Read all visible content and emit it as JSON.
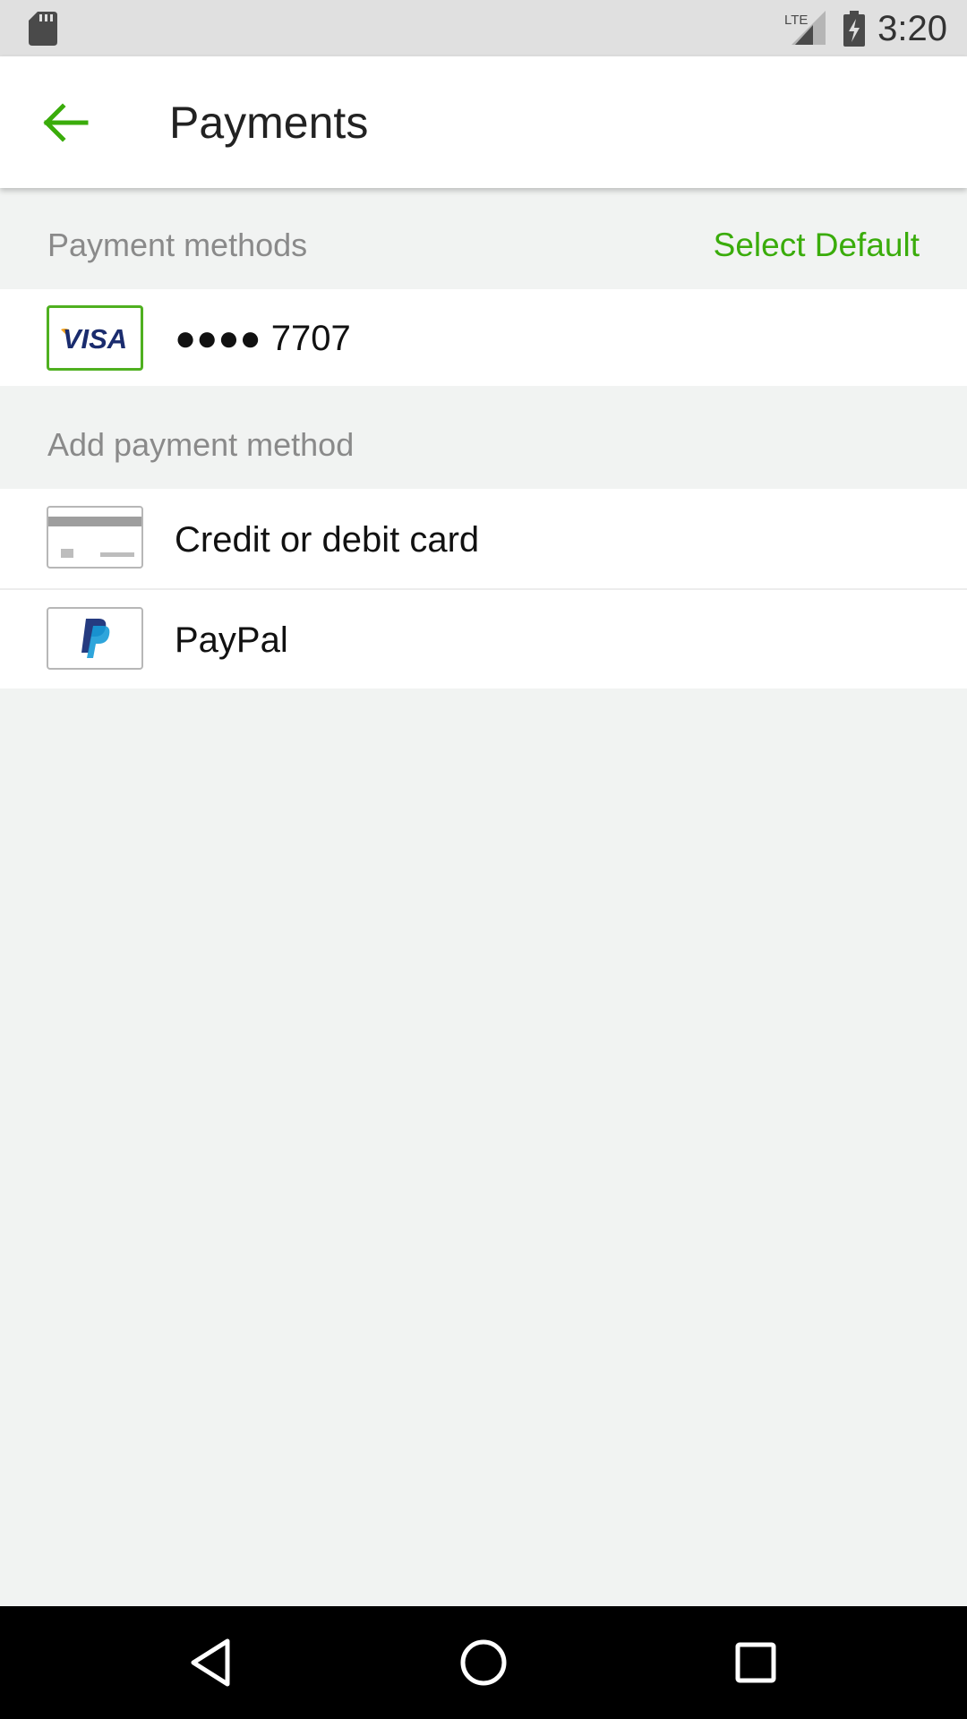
{
  "status_bar": {
    "time": "3:20",
    "network_label": "LTE",
    "icons": [
      "sd-card-icon",
      "lte-signal-icon",
      "battery-charging-icon"
    ]
  },
  "app_bar": {
    "title": "Payments",
    "back_icon": "arrow-back-icon"
  },
  "payment_methods": {
    "header": "Payment methods",
    "select_default_label": "Select Default",
    "items": [
      {
        "brand": "VISA",
        "masked_number": "●●●● 7707",
        "icon": "visa-card-icon"
      }
    ]
  },
  "add_payment_method": {
    "header": "Add payment method",
    "options": [
      {
        "label": "Credit or debit card",
        "icon": "credit-card-icon"
      },
      {
        "label": "PayPal",
        "icon": "paypal-icon"
      }
    ]
  },
  "nav_bar": {
    "icons": [
      "back-triangle-icon",
      "home-circle-icon",
      "recents-square-icon"
    ]
  },
  "colors": {
    "accent": "#3aac0b",
    "background": "#f1f3f2",
    "status_bar": "#e0e0e0",
    "nav_bar": "#000000"
  }
}
